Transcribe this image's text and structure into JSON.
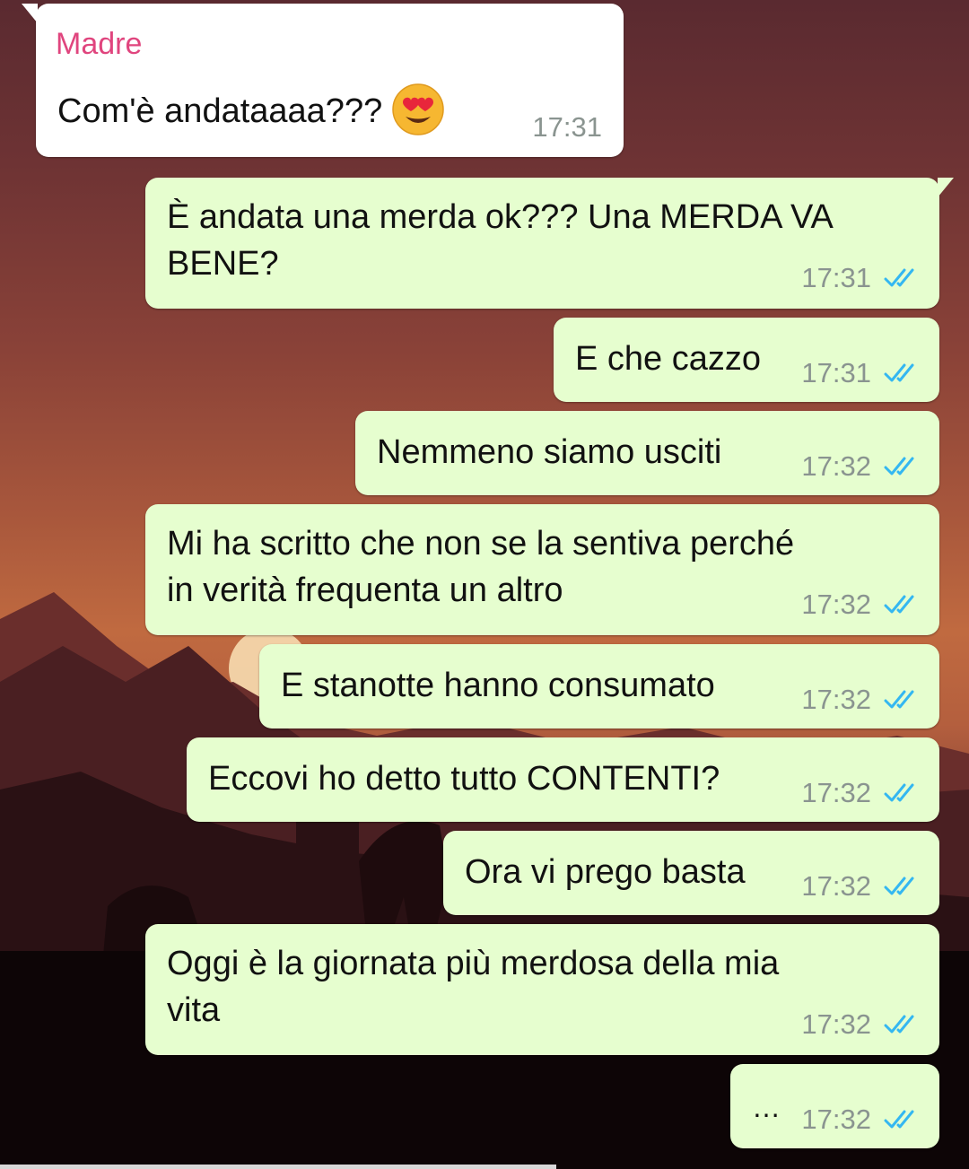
{
  "chat": {
    "contact_name": "Madre",
    "colors": {
      "incoming_bubble": "#ffffff",
      "outgoing_bubble": "#e6fecf",
      "sender_name": "#e0457e",
      "read_ticks": "#34b7f1",
      "timestamp": "#8a9490"
    },
    "messages": [
      {
        "direction": "in",
        "sender": "Madre",
        "text": "Com'è andataaaa???",
        "emoji": "heart-eyes-emoji",
        "time": "17:31"
      },
      {
        "direction": "out",
        "lines": [
          "È andata una merda ok??? Una MERDA VA",
          "BENE?"
        ],
        "time": "17:31",
        "status": "read"
      },
      {
        "direction": "out",
        "lines": [
          "E che cazzo"
        ],
        "time": "17:31",
        "status": "read"
      },
      {
        "direction": "out",
        "lines": [
          "Nemmeno siamo usciti"
        ],
        "time": "17:32",
        "status": "read"
      },
      {
        "direction": "out",
        "lines": [
          "Mi ha scritto che non se la sentiva perché",
          "in verità frequenta un altro"
        ],
        "time": "17:32",
        "status": "read"
      },
      {
        "direction": "out",
        "lines": [
          "E stanotte hanno consumato"
        ],
        "time": "17:32",
        "status": "read"
      },
      {
        "direction": "out",
        "lines": [
          "Eccovi ho detto tutto CONTENTI?"
        ],
        "time": "17:32",
        "status": "read"
      },
      {
        "direction": "out",
        "lines": [
          "Ora vi prego basta"
        ],
        "time": "17:32",
        "status": "read"
      },
      {
        "direction": "out",
        "lines": [
          "Oggi è la giornata più merdosa della mia",
          "vita"
        ],
        "time": "17:32",
        "status": "read"
      },
      {
        "direction": "out",
        "lines": [
          "…"
        ],
        "time": "17:32",
        "status": "read"
      }
    ]
  }
}
